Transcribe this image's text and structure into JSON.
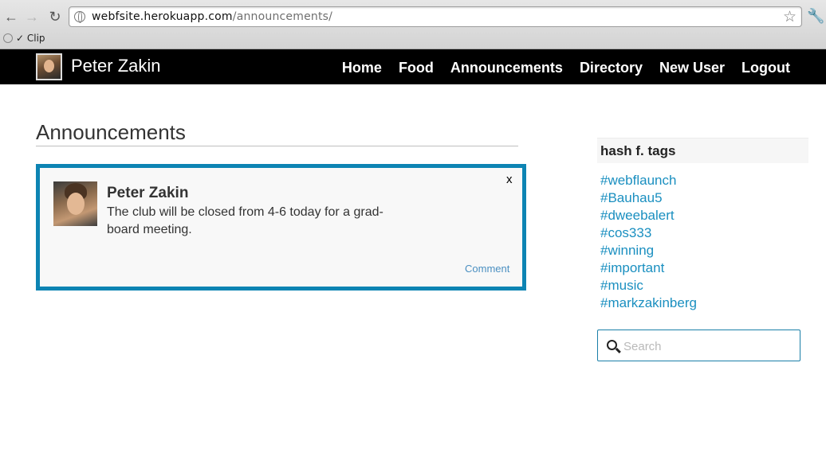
{
  "browser": {
    "url_host": "webfsite.herokuapp.com",
    "url_path": "/announcements/",
    "bookmark_label": "✓ Clip"
  },
  "navbar": {
    "brand": "Peter Zakin",
    "links": [
      "Home",
      "Food",
      "Announcements",
      "Directory",
      "New User",
      "Logout"
    ]
  },
  "main": {
    "title": "Announcements",
    "announcement": {
      "close_label": "x",
      "author": "Peter Zakin",
      "text": "The club will be closed from 4-6 today for a grad-board meeting.",
      "comment_label": "Comment"
    }
  },
  "sidebar": {
    "heading": "hash f. tags",
    "tags": [
      "#webflaunch",
      "#Bauhau5",
      "#dweebalert",
      "#cos333",
      "#winning",
      "#important",
      "#music",
      "#markzakinberg"
    ],
    "search_placeholder": "Search"
  },
  "colors": {
    "accent": "#0d84b3",
    "tag_link": "#1a8fc0",
    "navbar_bg": "#000000"
  }
}
